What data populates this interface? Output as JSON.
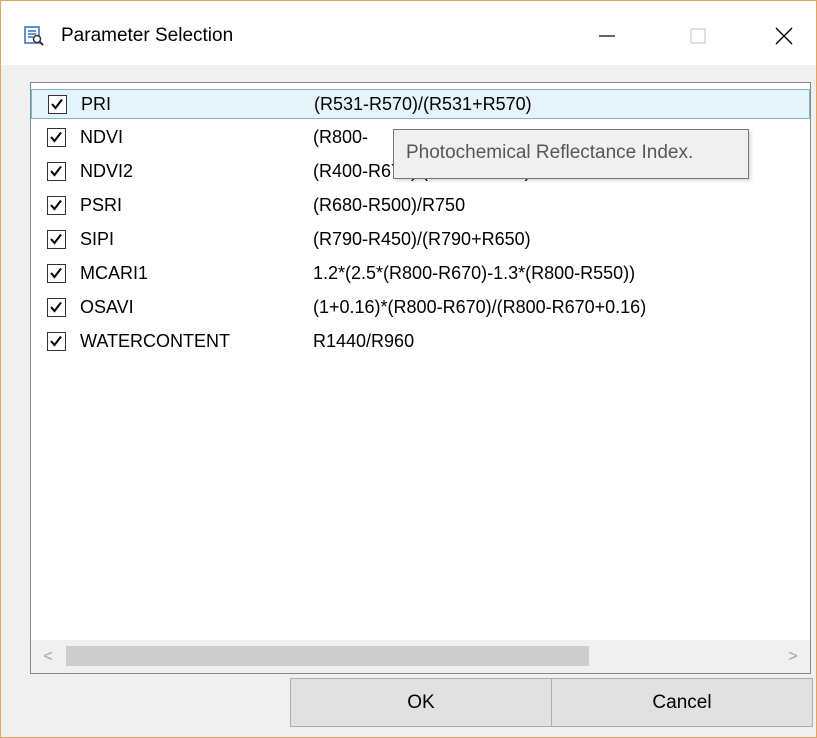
{
  "window": {
    "title": "Parameter Selection",
    "minimize_glyph": "—",
    "close_glyph": "✕"
  },
  "parameters": [
    {
      "name": "PRI",
      "formula": "(R531-R570)/(R531+R570)",
      "checked": true
    },
    {
      "name": "NDVI",
      "formula": "(R800-",
      "checked": true
    },
    {
      "name": "NDVI2",
      "formula": "(R400-R670)/(R400+R670)",
      "checked": true
    },
    {
      "name": "PSRI",
      "formula": "(R680-R500)/R750",
      "checked": true
    },
    {
      "name": "SIPI",
      "formula": "(R790-R450)/(R790+R650)",
      "checked": true
    },
    {
      "name": "MCARI1",
      "formula": "1.2*(2.5*(R800-R670)-1.3*(R800-R550))",
      "checked": true
    },
    {
      "name": "OSAVI",
      "formula": "(1+0.16)*(R800-R670)/(R800-R670+0.16)",
      "checked": true
    },
    {
      "name": "WATERCONTENT",
      "formula": "R1440/R960",
      "checked": true
    }
  ],
  "tooltip": {
    "text": "Photochemical Reflectance Index."
  },
  "scrollbar": {
    "left_arrow": "<",
    "right_arrow": ">"
  },
  "buttons": {
    "ok": "OK",
    "cancel": "Cancel"
  },
  "colors": {
    "selection": "#e5f3fb",
    "selection_border": "#7ab8d8",
    "accent": "#e6a35e"
  }
}
